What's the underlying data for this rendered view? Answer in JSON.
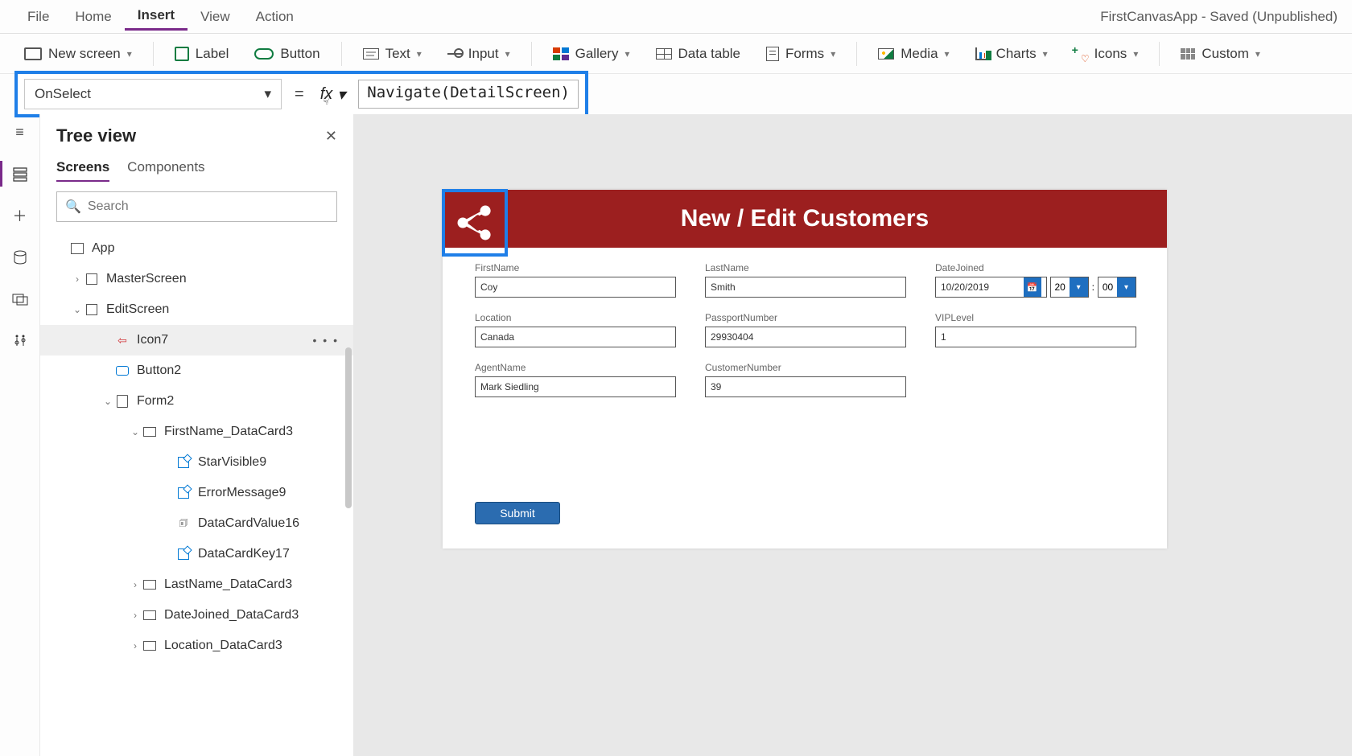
{
  "menubar": {
    "items": [
      "File",
      "Home",
      "Insert",
      "View",
      "Action"
    ],
    "active": "Insert",
    "app_title": "FirstCanvasApp - Saved (Unpublished)"
  },
  "ribbon": {
    "new_screen": "New screen",
    "label": "Label",
    "button": "Button",
    "text": "Text",
    "input": "Input",
    "gallery": "Gallery",
    "data_table": "Data table",
    "forms": "Forms",
    "media": "Media",
    "charts": "Charts",
    "icons": "Icons",
    "custom": "Custom"
  },
  "formula": {
    "property": "OnSelect",
    "fx": "fx",
    "expression": "Navigate(DetailScreen)"
  },
  "tree": {
    "title": "Tree view",
    "tabs": {
      "screens": "Screens",
      "components": "Components"
    },
    "search_placeholder": "Search",
    "items": {
      "app": "App",
      "master": "MasterScreen",
      "edit": "EditScreen",
      "icon7": "Icon7",
      "button2": "Button2",
      "form2": "Form2",
      "firstname_card": "FirstName_DataCard3",
      "starvisible": "StarVisible9",
      "errmsg": "ErrorMessage9",
      "dcvalue": "DataCardValue16",
      "dckey": "DataCardKey17",
      "lastname_card": "LastName_DataCard3",
      "datejoined_card": "DateJoined_DataCard3",
      "location_card": "Location_DataCard3"
    }
  },
  "canvas": {
    "title": "New / Edit Customers",
    "fields": {
      "firstname": {
        "label": "FirstName",
        "value": "Coy"
      },
      "lastname": {
        "label": "LastName",
        "value": "Smith"
      },
      "datejoined": {
        "label": "DateJoined",
        "date": "10/20/2019",
        "hour": "20",
        "minute": "00"
      },
      "location": {
        "label": "Location",
        "value": "Canada"
      },
      "passport": {
        "label": "PassportNumber",
        "value": "29930404"
      },
      "vip": {
        "label": "VIPLevel",
        "value": "1"
      },
      "agent": {
        "label": "AgentName",
        "value": "Mark Siedling"
      },
      "custnum": {
        "label": "CustomerNumber",
        "value": "39"
      }
    },
    "submit": "Submit"
  }
}
